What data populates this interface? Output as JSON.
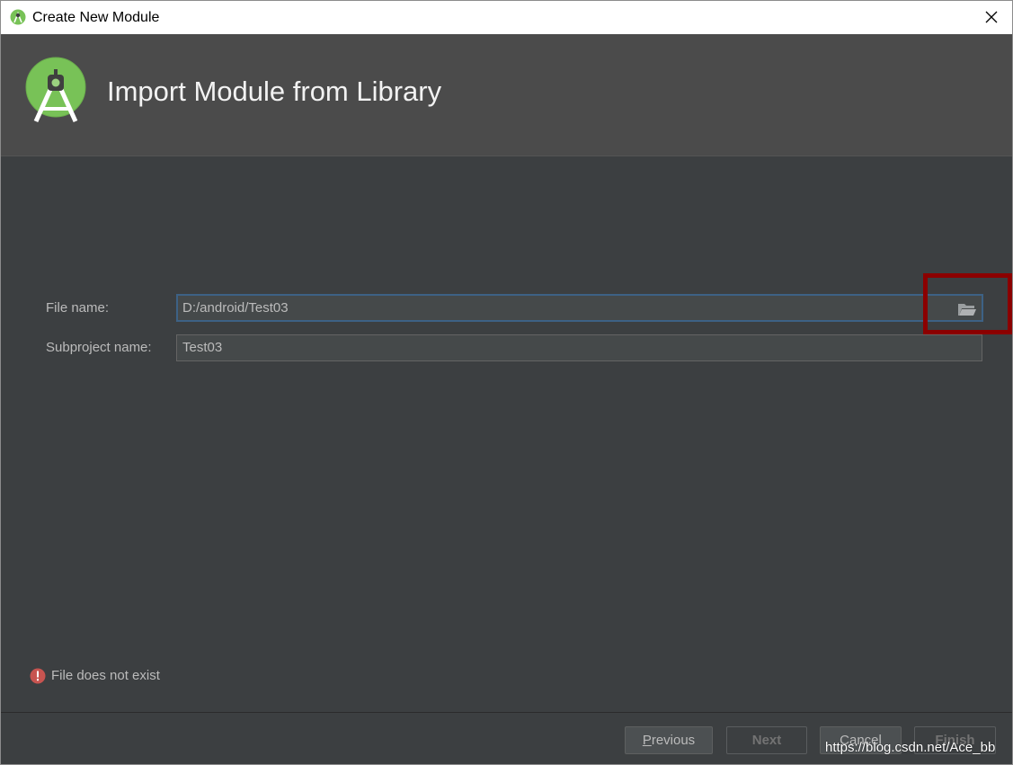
{
  "window": {
    "title": "Create New Module",
    "close_glyph": "✕"
  },
  "banner": {
    "title": "Import Module from Library",
    "logo_icon": "android-studio-logo-icon"
  },
  "form": {
    "file_name_label": "File name:",
    "file_name_value": "D:/android/Test03",
    "browse_icon": "folder-open-icon",
    "subproject_label": "Subproject name:",
    "subproject_value": "Test03"
  },
  "error": {
    "icon": "error-icon",
    "message": "File does not exist"
  },
  "footer": {
    "previous_first": "P",
    "previous_rest": "revious",
    "next_label": "Next",
    "cancel_label": "Cancel",
    "finish_label": "Finish"
  },
  "colors": {
    "background": "#3c3f41",
    "banner": "#4b4b4b",
    "focus_border": "#3d6185",
    "highlight": "#8b0000",
    "error_red": "#c75450"
  },
  "watermark": "https://blog.csdn.net/Ace_bb"
}
